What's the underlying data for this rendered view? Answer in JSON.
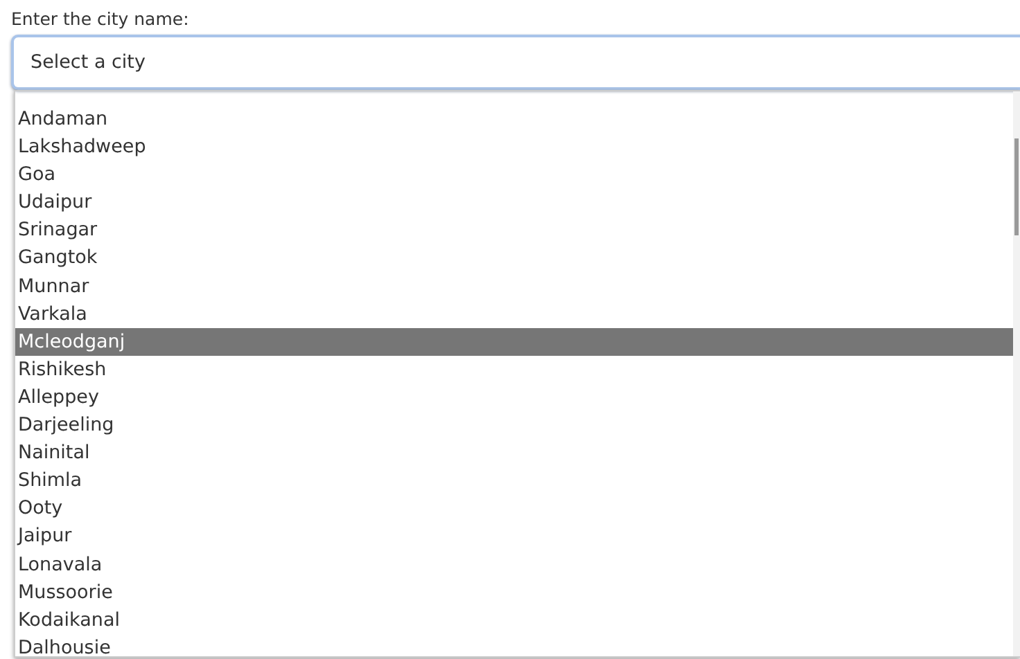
{
  "label": "Enter the city name:",
  "field": {
    "placeholder": "Select a city"
  },
  "options": [
    {
      "label": "Andaman",
      "selected": false
    },
    {
      "label": "Lakshadweep",
      "selected": false
    },
    {
      "label": "Goa",
      "selected": false
    },
    {
      "label": "Udaipur",
      "selected": false
    },
    {
      "label": "Srinagar",
      "selected": false
    },
    {
      "label": "Gangtok",
      "selected": false
    },
    {
      "label": "Munnar",
      "selected": false
    },
    {
      "label": "Varkala",
      "selected": false
    },
    {
      "label": "Mcleodganj",
      "selected": true
    },
    {
      "label": "Rishikesh",
      "selected": false
    },
    {
      "label": "Alleppey",
      "selected": false
    },
    {
      "label": "Darjeeling",
      "selected": false
    },
    {
      "label": "Nainital",
      "selected": false
    },
    {
      "label": "Shimla",
      "selected": false
    },
    {
      "label": "Ooty",
      "selected": false
    },
    {
      "label": "Jaipur",
      "selected": false
    },
    {
      "label": "Lonavala",
      "selected": false
    },
    {
      "label": "Mussoorie",
      "selected": false
    },
    {
      "label": "Kodaikanal",
      "selected": false
    },
    {
      "label": "Dalhousie",
      "selected": false
    }
  ]
}
